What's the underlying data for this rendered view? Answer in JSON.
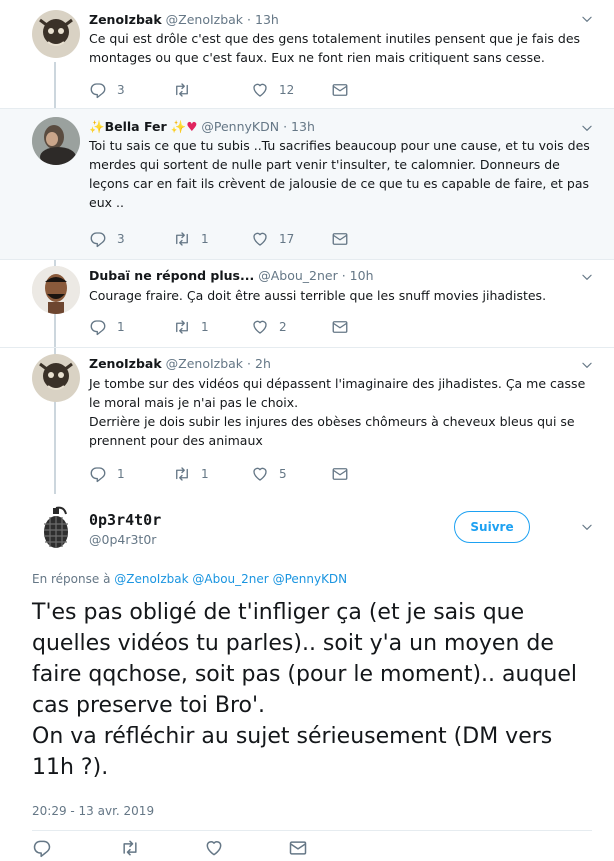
{
  "tweets": [
    {
      "name": "ZenoIzbak",
      "handle": "@ZenoIzbak",
      "time": "13h",
      "text": [
        "Ce qui est drôle c'est que des gens totalement inutiles pensent que je fais des montages ou que c'est faux. Eux ne font rien mais critiquent sans cesse."
      ],
      "replies": "3",
      "retweets": "",
      "likes": "12"
    },
    {
      "name": "Bella Fer",
      "name_prefix_emoji": "✨",
      "name_suffix_emoji": "✨💞",
      "handle": "@PennyKDN",
      "time": "13h",
      "text": [
        "Toi tu sais ce que tu subis ..Tu sacrifies beaucoup pour une cause, et tu vois des merdes qui sortent de nulle part venir t'insulter, te calomnier. Donneurs de leçons car en fait ils crèvent de jalousie de ce que tu es capable de faire, et pas eux .."
      ],
      "replies": "3",
      "retweets": "1",
      "likes": "17"
    },
    {
      "name": "Dubaï ne répond plus...",
      "handle": "@Abou_2ner",
      "time": "10h",
      "text": [
        "Courage fraire. Ça doit être aussi terrible que les snuff movies jihadistes."
      ],
      "replies": "1",
      "retweets": "1",
      "likes": "2"
    },
    {
      "name": "ZenoIzbak",
      "handle": "@ZenoIzbak",
      "time": "2h",
      "text": [
        "Je tombe sur des vidéos qui dépassent l'imaginaire des jihadistes. Ça me casse le moral mais je n'ai pas le choix.",
        "Derrière je dois subir les injures des obèses chômeurs à cheveux bleus qui se prennent pour des animaux"
      ],
      "replies": "1",
      "retweets": "1",
      "likes": "5"
    }
  ],
  "main": {
    "name": "0p3r4t0r",
    "handle": "@0p4r3t0r",
    "follow_label": "Suivre",
    "reply_prefix": "En réponse à",
    "reply_mentions": [
      "@ZenoIzbak",
      "@Abou_2ner",
      "@PennyKDN"
    ],
    "text": [
      "T'es pas obligé de t'infliger ça (et je sais que quelles vidéos tu parles).. soit y'a un moyen de faire qqchose, soit pas (pour le moment).. auquel cas preserve toi Bro'.",
      "On va réfléchir au sujet sérieusement (DM vers 11h ?)."
    ],
    "timestamp": "20:29 - 13 avr. 2019"
  },
  "colors": {
    "accent": "#1da1f2",
    "link": "#1b95e0",
    "muted": "#657786",
    "highlight_bg": "#f5f8fa",
    "thread_line": "#ccd6dd"
  },
  "icons": [
    "reply-icon",
    "retweet-icon",
    "like-icon",
    "dm-icon",
    "chevron-down-icon"
  ]
}
